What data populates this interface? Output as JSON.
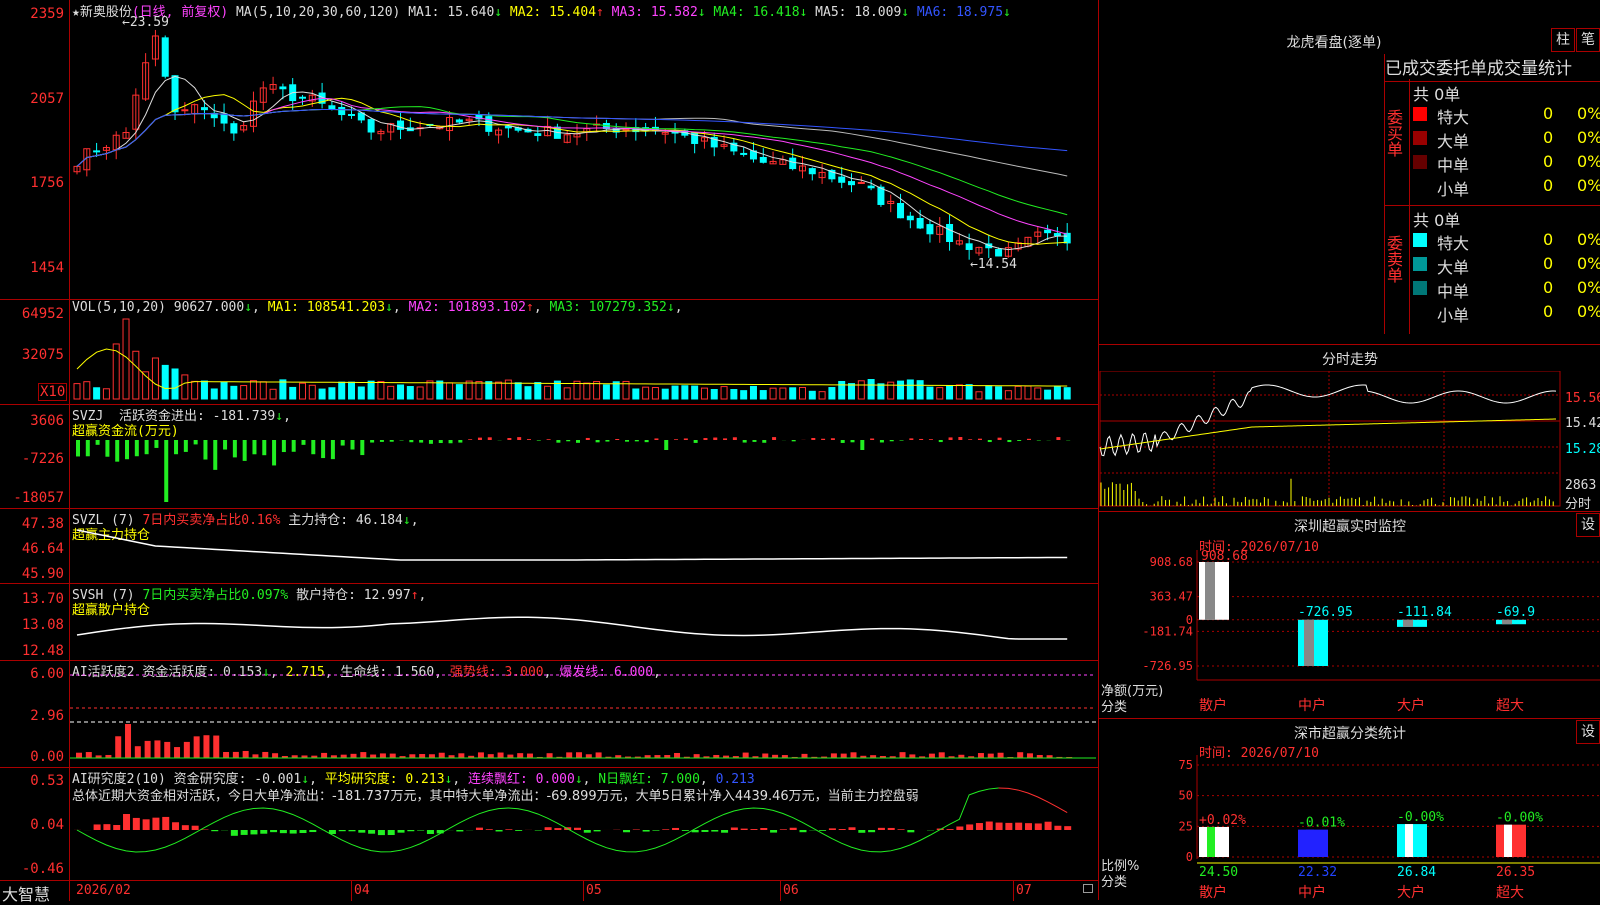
{
  "stock": {
    "name": "新奥股份",
    "mode": "(日线, 前复权)"
  },
  "main": {
    "ma_header": "MA(5,10,20,30,60,120)",
    "ma": [
      {
        "label": "MA1:",
        "value": "15.640",
        "arrow": "↓",
        "color": "#dddddd"
      },
      {
        "label": "MA2:",
        "value": "15.404",
        "arrow": "↑",
        "color": "#ffff00"
      },
      {
        "label": "MA3:",
        "value": "15.582",
        "arrow": "↓",
        "color": "#ff44ff"
      },
      {
        "label": "MA4:",
        "value": "16.418",
        "arrow": "↓",
        "color": "#22ee22"
      },
      {
        "label": "MA5:",
        "value": "18.009",
        "arrow": "↓",
        "color": "#dddddd"
      },
      {
        "label": "MA6:",
        "value": "18.975",
        "arrow": "↓",
        "color": "#3355ff"
      }
    ],
    "y_ticks": [
      "2359",
      "2057",
      "1756",
      "1454"
    ],
    "high_label": "23.59",
    "low_label": "14.54",
    "colors": {
      "up": "#ff3030",
      "down": "#00ffff",
      "ma1": "#dddddd",
      "ma2": "#ffff00",
      "ma3": "#ff44ff",
      "ma4": "#22ee22",
      "ma5": "#bbbbbb",
      "ma6": "#3355ff"
    }
  },
  "vol": {
    "title": "VOL(5,10,20)",
    "value": "90627.000",
    "value_arrow": "↓",
    "ma": [
      {
        "label": "MA1:",
        "value": "108541.203",
        "arrow": "↓",
        "color": "#ffff00"
      },
      {
        "label": "MA2:",
        "value": "101893.102",
        "arrow": "↑",
        "color": "#ff44ff"
      },
      {
        "label": "MA3:",
        "value": "107279.352",
        "arrow": "↓",
        "color": "#22ee22"
      }
    ],
    "y_ticks": [
      "64952",
      "32075"
    ],
    "unit": "X10"
  },
  "svzj": {
    "title": "SVZJ",
    "label": "活跃资金进出:",
    "value": "-181.739",
    "arrow": "↓",
    "sub": "超赢资金流(万元)",
    "y_ticks": [
      "3606",
      "-7226",
      "-18057"
    ]
  },
  "svzl": {
    "title": "SVZL (7)",
    "ratio": "7日内买卖净占比0.16%",
    "label": "主力持仓:",
    "value": "46.184",
    "arrow": "↓",
    "sub": "超赢主力持仓",
    "y_ticks": [
      "47.38",
      "46.64",
      "45.90"
    ]
  },
  "svsh": {
    "title": "SVSH (7)",
    "ratio": "7日内买卖净占比0.097%",
    "label": "散户持仓:",
    "value": "12.997",
    "arrow": "↑",
    "sub": "超赢散户持仓",
    "y_ticks": [
      "13.70",
      "13.08",
      "12.48"
    ]
  },
  "ai1": {
    "title": "AI活跃度2",
    "label": "资金活跃度:",
    "value": "0.153",
    "arrow": "↓",
    "v2": "2.715",
    "life": "生命线: 1.560",
    "strong": "强势线: 3.000",
    "burst": "爆发线: 6.000",
    "y_ticks": [
      "6.00",
      "2.96",
      "0.00"
    ]
  },
  "ai2": {
    "title": "AI研究度2(10)",
    "label": "资金研究度:",
    "value": "-0.001",
    "arrow": "↓",
    "avg": "平均研究度: 0.213",
    "avg_arrow": "↓",
    "cont": "连续飘红: 0.000",
    "cont_arrow": "↓",
    "nday": "N日飘红: 7.000",
    "extra": "0.213",
    "text": "总体近期大资金相对活跃，今日大单净流出：-181.737万元，其中特大单净流出：-69.899万元，大单5日累计净入4439.46万元，当前主力控盘弱",
    "y_ticks": [
      "0.53",
      "0.04",
      "-0.46"
    ]
  },
  "x_axis": {
    "labels": [
      "2026/02",
      "04",
      "05",
      "06",
      "07"
    ],
    "logo": "大智慧"
  },
  "lhb": {
    "title": "龙虎看盘(逐单)",
    "btn1": "柱",
    "btn2": "笔",
    "subtitle": "已成交委托单成交量统计",
    "buy": {
      "side": "委买单",
      "total": "共 0单",
      "rows": [
        {
          "name": "特大",
          "count": "0",
          "pct": "0%",
          "color": "#ff0000"
        },
        {
          "name": "大单",
          "count": "0",
          "pct": "0%",
          "color": "#990000"
        },
        {
          "name": "中单",
          "count": "0",
          "pct": "0%",
          "color": "#660000"
        },
        {
          "name": "小单",
          "count": "0",
          "pct": "0%",
          "color": ""
        }
      ]
    },
    "sell": {
      "side": "委卖单",
      "total": "共 0单",
      "rows": [
        {
          "name": "特大",
          "count": "0",
          "pct": "0%",
          "color": "#00ffff"
        },
        {
          "name": "大单",
          "count": "0",
          "pct": "0%",
          "color": "#009999"
        },
        {
          "name": "中单",
          "count": "0",
          "pct": "0%",
          "color": "#007777"
        },
        {
          "name": "小单",
          "count": "0",
          "pct": "0%",
          "color": ""
        }
      ]
    }
  },
  "intraday": {
    "title": "分时走势",
    "prices": [
      "15.56",
      "15.42",
      "15.28"
    ],
    "vol": "2863",
    "vol_unit": "分时"
  },
  "monitor": {
    "title": "深圳超赢实时监控",
    "btn": "设",
    "time": "时间: 2026/07/10",
    "y_ticks": [
      "908.68",
      "363.47",
      "0",
      "-181.74",
      "-726.95"
    ],
    "ylabel1": "净额(万元)",
    "ylabel2": "分类",
    "bars": [
      {
        "cat": "散户",
        "value": 908.68,
        "label": "908.68",
        "color": "#ffffff"
      },
      {
        "cat": "中户",
        "value": -726.95,
        "label": "-726.95",
        "color": "#00ffff"
      },
      {
        "cat": "大户",
        "value": -111.84,
        "label": "-111.84",
        "color": "#00ffff"
      },
      {
        "cat": "超大",
        "value": -69.9,
        "label": "-69.9",
        "color": "#00ffff"
      }
    ]
  },
  "classify": {
    "title": "深市超赢分类统计",
    "btn": "设",
    "time": "时间: 2026/07/10",
    "y_ticks": [
      "75",
      "50",
      "25",
      "0"
    ],
    "ylabel1": "比例%",
    "ylabel2": "分类",
    "bars": [
      {
        "cat": "散户",
        "value": 24.5,
        "label": "24.50",
        "delta": "+0.02%",
        "color": "#ffffff",
        "accent": "#22ee22",
        "label_color": "#22ee22",
        "delta_color": "#ff3030"
      },
      {
        "cat": "中户",
        "value": 22.32,
        "label": "22.32",
        "delta": "-0.01%",
        "color": "#2222ff",
        "accent": "#2222ff",
        "label_color": "#2244ff",
        "delta_color": "#22ee22"
      },
      {
        "cat": "大户",
        "value": 26.84,
        "label": "26.84",
        "delta": "-0.00%",
        "color": "#00ffff",
        "accent": "#ffffff",
        "label_color": "#00ffff",
        "delta_color": "#22ee22"
      },
      {
        "cat": "超大",
        "value": 26.35,
        "label": "26.35",
        "delta": "-0.00%",
        "color": "#ff3030",
        "accent": "#ffffff",
        "label_color": "#ff3030",
        "delta_color": "#22ee22"
      }
    ]
  }
}
